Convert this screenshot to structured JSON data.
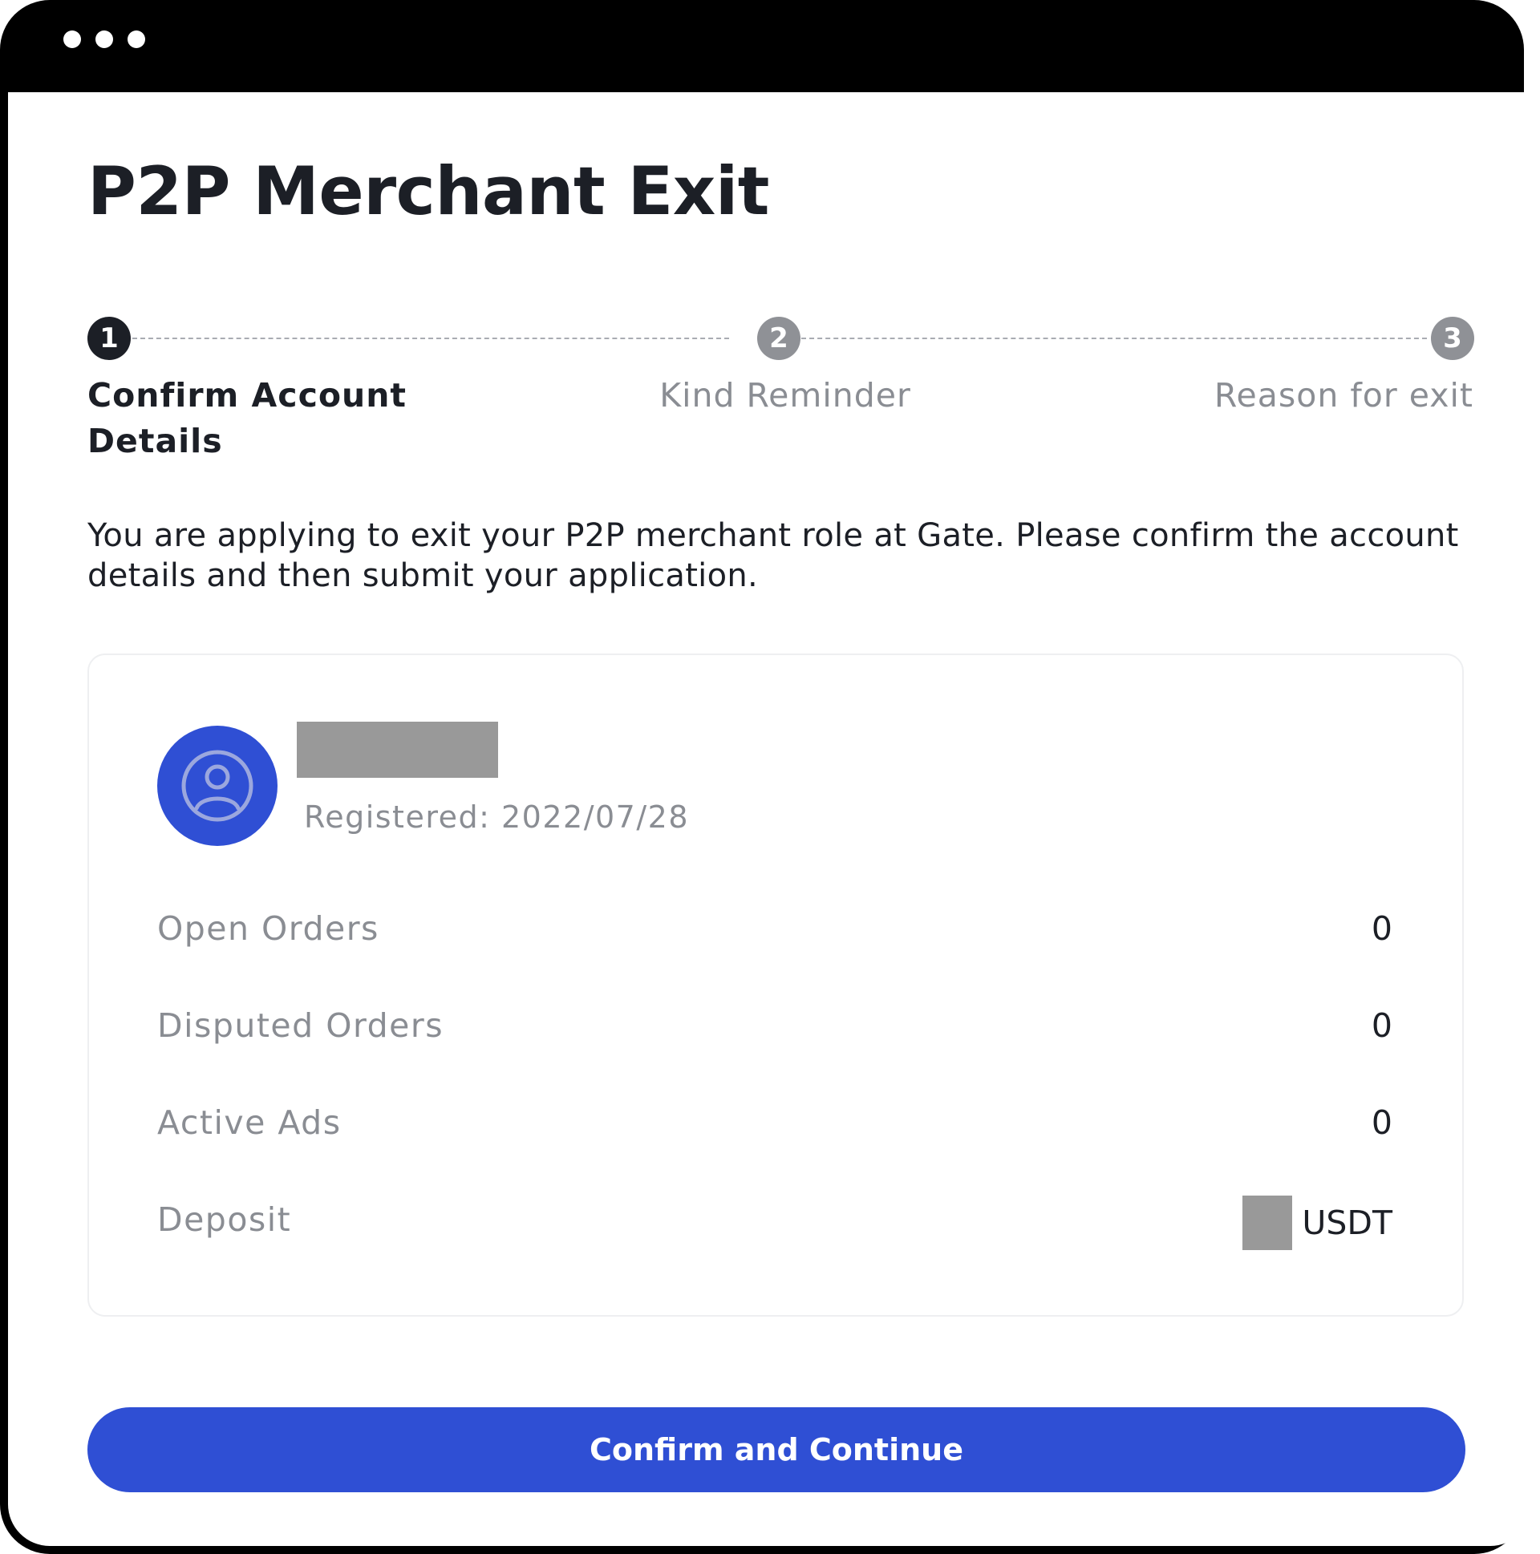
{
  "window": {
    "controls": [
      "dot",
      "dot",
      "dot"
    ]
  },
  "page": {
    "title": "P2P Merchant Exit",
    "intro": "You are applying to exit your P2P merchant role at Gate. Please confirm the account details and then submit your application."
  },
  "stepper": {
    "steps": [
      {
        "number": "1",
        "label": "Confirm Account Details",
        "state": "active"
      },
      {
        "number": "2",
        "label": "Kind Reminder",
        "state": "inactive"
      },
      {
        "number": "3",
        "label": "Reason for exit",
        "state": "inactive"
      }
    ]
  },
  "account": {
    "avatar_icon": "user-circle-icon",
    "name": "",
    "registered": "Registered: 2022/07/28",
    "stats": [
      {
        "label": "Open Orders",
        "value": "0"
      },
      {
        "label": "Disputed Orders",
        "value": "0"
      },
      {
        "label": "Active Ads",
        "value": "0"
      },
      {
        "label": "Deposit",
        "value": "",
        "unit": "USDT"
      }
    ]
  },
  "actions": {
    "confirm_label": "Confirm and Continue"
  },
  "colors": {
    "accent": "#2f4fd4",
    "text_primary": "#1c1f26",
    "text_muted": "#8a8d93",
    "redaction": "#999999"
  }
}
